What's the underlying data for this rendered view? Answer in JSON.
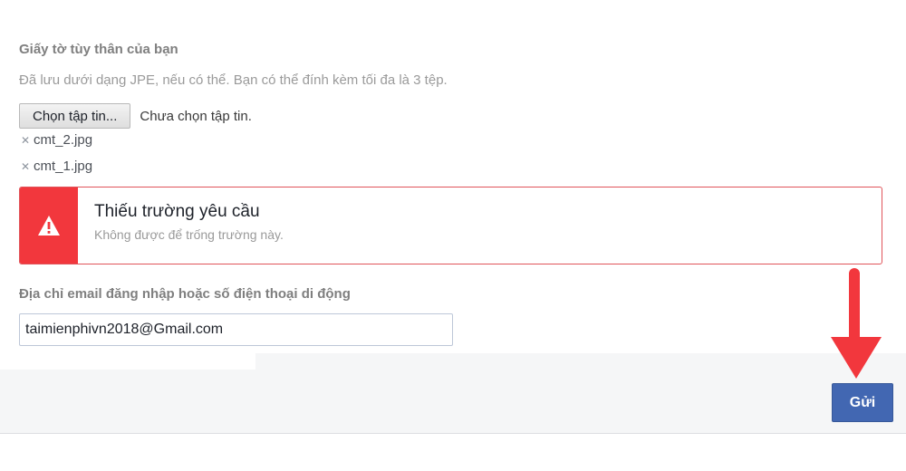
{
  "identity_section": {
    "label": "Giấy tờ tùy thân của bạn",
    "hint": "Đã lưu dưới dạng JPE, nếu có thể. Bạn có thể đính kèm tối đa là 3 tệp.",
    "file_button_label": "Chọn tập tin...",
    "file_status": "Chưa chọn tập tin.",
    "files": [
      {
        "name": "cmt_2.jpg",
        "remove_icon": "close-icon"
      },
      {
        "name": "cmt_1.jpg",
        "remove_icon": "close-icon"
      }
    ]
  },
  "error": {
    "icon": "warning-icon",
    "title": "Thiếu trường yêu cầu",
    "description": "Không được để trống trường này.",
    "color": "#f2373d"
  },
  "email_section": {
    "label": "Địa chỉ email đăng nhập hoặc số điện thoại di động",
    "value": "taimienphivn2018@Gmail.com",
    "placeholder": ""
  },
  "footer": {
    "send_label": "Gửi",
    "send_color": "#4267b2"
  },
  "annotation": {
    "arrow_color": "#f2373d",
    "icon": "arrow-down-icon"
  }
}
